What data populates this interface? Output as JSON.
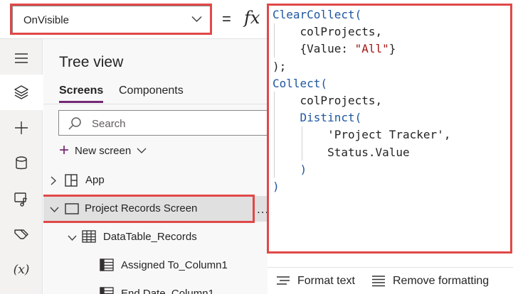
{
  "formula_bar": {
    "property": "OnVisible",
    "equals": "=",
    "fx": "fx"
  },
  "rail": {
    "items": [
      "menu-icon",
      "layers-icon",
      "plus-icon",
      "database-icon",
      "media-icon",
      "power-automate-icon",
      "variables-icon"
    ],
    "variables_label": "(x)"
  },
  "tree_view": {
    "title": "Tree view",
    "tabs": [
      {
        "label": "Screens",
        "active": true
      },
      {
        "label": "Components",
        "active": false
      }
    ],
    "search_placeholder": "Search",
    "new_screen_label": "New screen",
    "nodes": [
      {
        "label": "App",
        "icon": "app-icon"
      },
      {
        "label": "Project Records Screen",
        "icon": "screen-icon",
        "selected": true
      },
      {
        "label": "DataTable_Records",
        "icon": "table-icon"
      },
      {
        "label": "Assigned To_Column1",
        "icon": "column-icon"
      },
      {
        "label": "End Date_Column1",
        "icon": "column-icon"
      }
    ],
    "more_label": "..."
  },
  "editor": {
    "lines": [
      [
        {
          "t": "ClearCollect(",
          "c": "fn"
        }
      ],
      [
        {
          "t": "    colProjects,",
          "c": ""
        }
      ],
      [
        {
          "t": "    {Value: ",
          "c": ""
        },
        {
          "t": "\"All\"",
          "c": "str"
        },
        {
          "t": "}",
          "c": ""
        }
      ],
      [
        {
          "t": ");",
          "c": ""
        }
      ],
      [
        {
          "t": "Collect(",
          "c": "fn"
        }
      ],
      [
        {
          "t": "    colProjects,",
          "c": ""
        }
      ],
      [
        {
          "t": "    ",
          "c": ""
        },
        {
          "t": "Distinct(",
          "c": "fn"
        }
      ],
      [
        {
          "t": "        'Project Tracker',",
          "c": ""
        }
      ],
      [
        {
          "t": "        Status.Value",
          "c": ""
        }
      ],
      [
        {
          "t": "    )",
          "c": "fn"
        }
      ],
      [
        {
          "t": ")",
          "c": "fn"
        }
      ]
    ],
    "toolbar": {
      "format_text": "Format text",
      "remove_formatting": "Remove formatting"
    }
  },
  "colors": {
    "highlight": "#e04848",
    "accent": "#742774",
    "code_function": "#1e56a0",
    "code_string": "#a31515"
  }
}
